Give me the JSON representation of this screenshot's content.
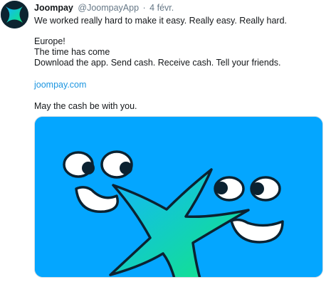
{
  "tweet": {
    "author_name": "Joompay",
    "author_handle": "@JoompayApp",
    "separator": "·",
    "date": "4 févr.",
    "lines": [
      "We worked really hard to make it easy. Really easy. Really hard.",
      "Europe!",
      "The time has come",
      "Download the app. Send cash. Receive cash. Tell your friends.",
      "joompay.com",
      "May the cash be with you."
    ]
  },
  "media": {
    "background_color": "#04a6ff",
    "gradient_start": "#13b5ff",
    "gradient_end": "#12e87f",
    "outline_color": "#0b2231"
  },
  "colors": {
    "text": "#14171a",
    "muted": "#657786",
    "link": "#1b95e0"
  }
}
